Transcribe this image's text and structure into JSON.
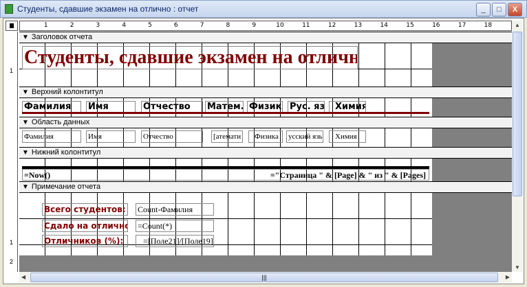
{
  "window": {
    "title": "Студенты, сдавшие экзамен на отлично : отчет",
    "min": "_",
    "max": "□",
    "close": "X"
  },
  "ruler": [
    "1",
    "2",
    "3",
    "4",
    "5",
    "6",
    "7",
    "8",
    "9",
    "10",
    "11",
    "12",
    "13",
    "14",
    "15",
    "16",
    "17",
    "18"
  ],
  "vruler": [
    "1",
    "2"
  ],
  "sections": {
    "report_header": "Заголовок отчета",
    "page_header": "Верхний колонтитул",
    "detail": "Область данных",
    "page_footer": "Нижний колонтитул",
    "report_footer": "Примечание отчета"
  },
  "report_title": "Студенты, сдавшие экзамен на отлично",
  "headers": [
    "Фамилия",
    "Имя",
    "Отчество",
    "Матем.",
    "Физика",
    "Рус. яз.",
    "Химия"
  ],
  "fields": [
    "Фамилия",
    "Имя",
    "Отчество",
    "[атемати",
    "Физика",
    "усский язь",
    "Химия"
  ],
  "footer": {
    "left": "=Now()",
    "right": "=\"Страница \" & [Page] & \" из \" & [Pages]"
  },
  "summary": [
    {
      "label": "Всего студентов:",
      "value": "Count-Фамилия"
    },
    {
      "label": "Сдало на отлично:",
      "value": "=Count(*)"
    },
    {
      "label": "Отличников (%):",
      "value": "=[Поле21]/[Поле19]"
    }
  ],
  "colors": {
    "title": "#800000",
    "line": "#800000"
  }
}
